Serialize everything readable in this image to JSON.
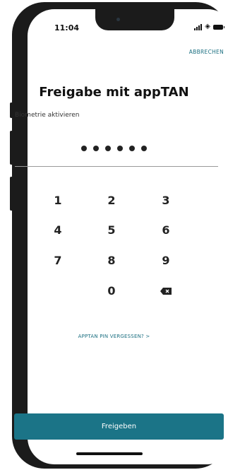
{
  "status_bar": {
    "time": "11:04"
  },
  "header": {
    "cancel_label": "ABBRECHEN"
  },
  "main": {
    "title": "Freigabe mit appTAN",
    "biometric_label": "Biometrie aktivieren",
    "pin_entered_count": 6,
    "keypad": [
      "1",
      "2",
      "3",
      "4",
      "5",
      "6",
      "7",
      "8",
      "9",
      "0"
    ],
    "backspace_icon": "backspace-icon",
    "forgot_pin_label": "APPTAN PIN VERGESSEN? >"
  },
  "footer": {
    "submit_label": "Freigeben"
  },
  "colors": {
    "accent": "#1b7487",
    "link": "#1b6f81"
  }
}
